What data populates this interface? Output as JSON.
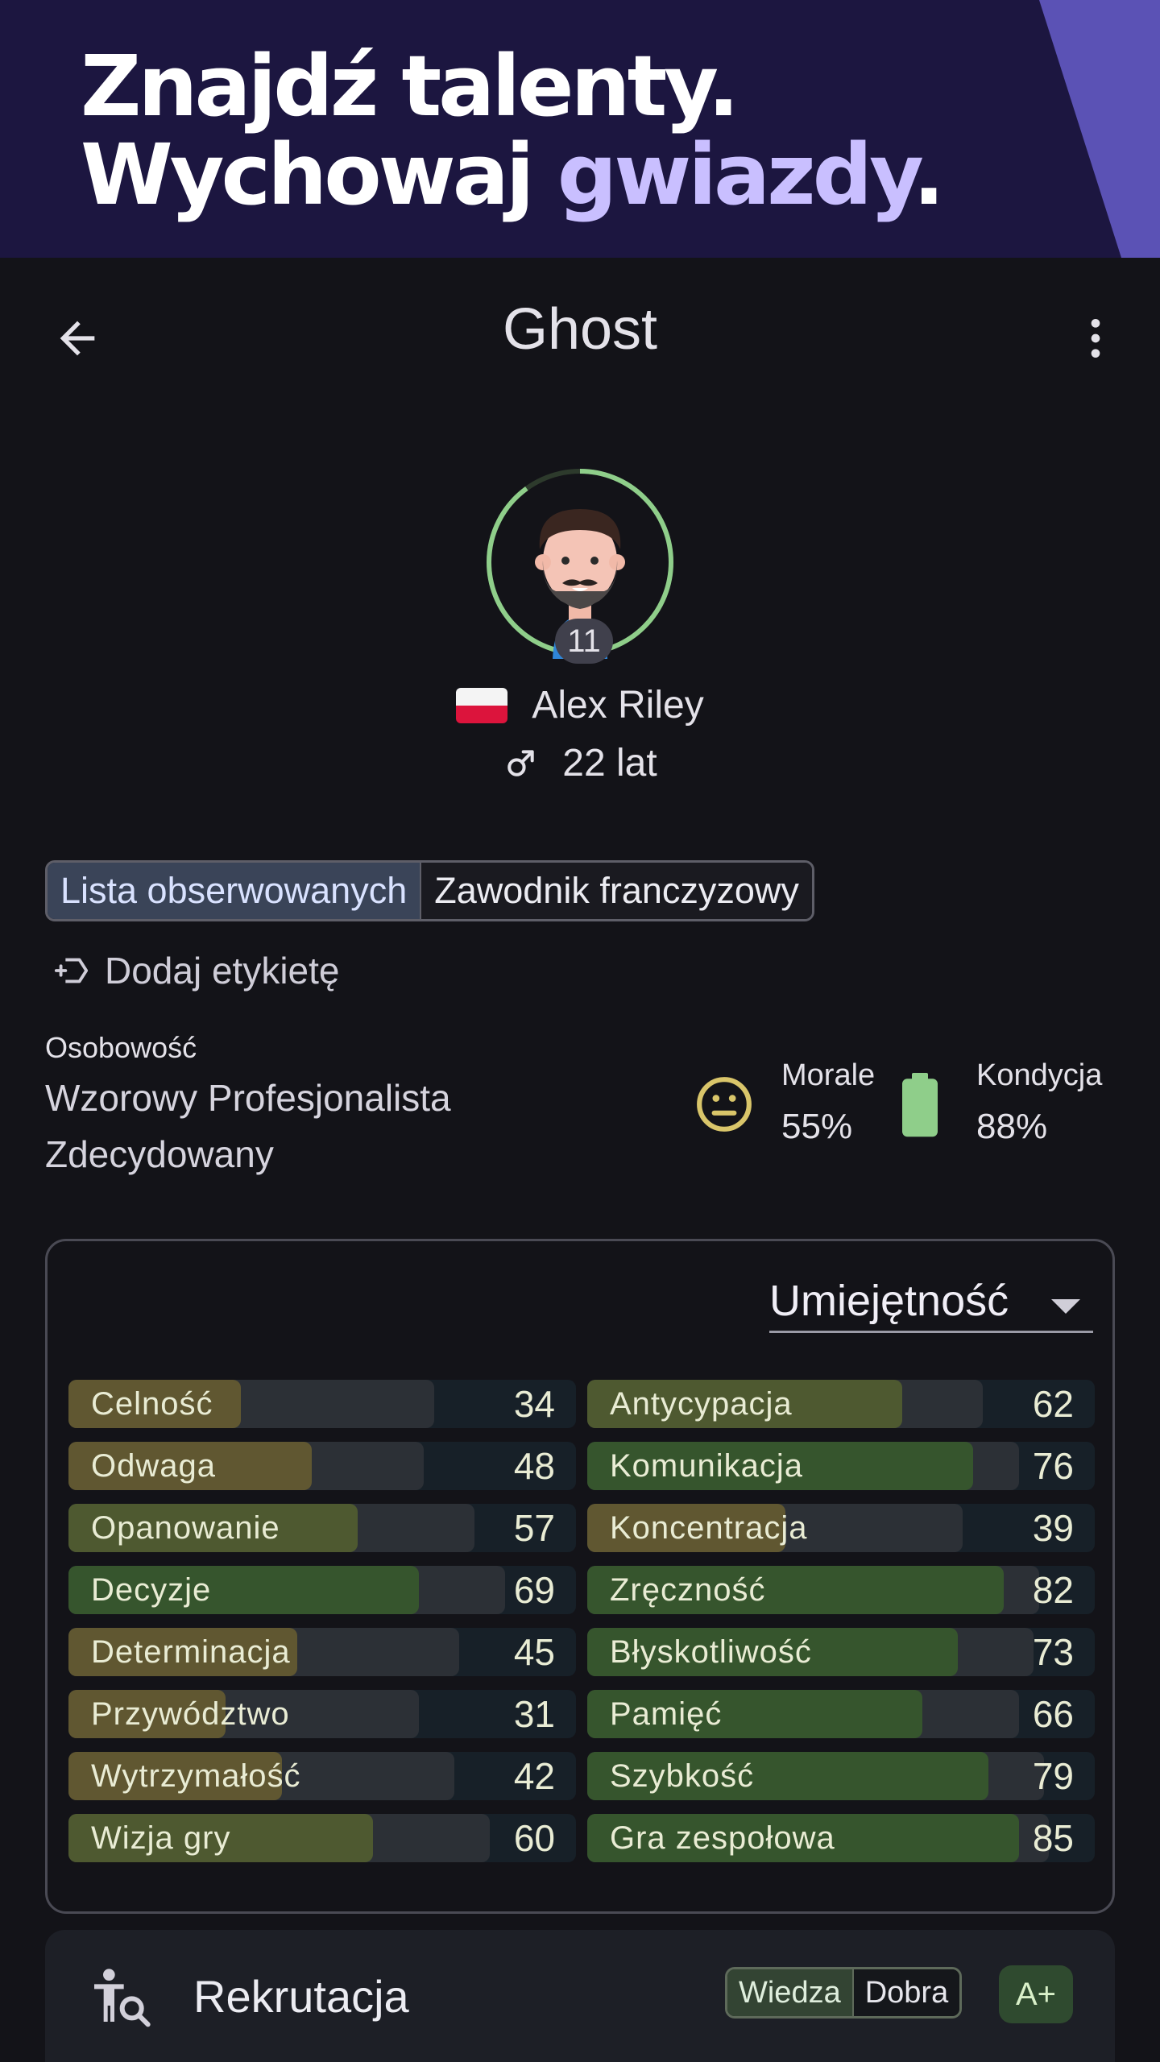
{
  "banner": {
    "line1": "Znajdź talenty.",
    "line2_start": "Wychowaj ",
    "line2_accent": "gwiazdy",
    "line2_end": "."
  },
  "header": {
    "title": "Ghost",
    "back_icon": "arrow-left-icon",
    "menu_icon": "more-vert-icon"
  },
  "player": {
    "level": "11",
    "name": "Alex Riley",
    "age": "22 lat",
    "nationality_flag": "poland-flag",
    "gender_icon": "male-icon",
    "ring_progress": 0.9
  },
  "tags": {
    "primary": "Lista obserwowanych",
    "secondary": "Zawodnik franczyzowy",
    "add_label": "Dodaj etykietę"
  },
  "personality": {
    "caption": "Osobowość",
    "line1": "Wzorowy Profesjonalista",
    "line2": "Zdecydowany"
  },
  "stats": {
    "morale": {
      "label": "Morale",
      "value": "55%"
    },
    "condition": {
      "label": "Kondycja",
      "value": "88%"
    }
  },
  "skills": {
    "selector": "Umiejętność",
    "left": [
      {
        "name": "Celność",
        "value": "34",
        "level": 34,
        "track": 72
      },
      {
        "name": "Odwaga",
        "value": "48",
        "level": 48,
        "track": 70
      },
      {
        "name": "Opanowanie",
        "value": "57",
        "level": 57,
        "track": 80
      },
      {
        "name": "Decyzje",
        "value": "69",
        "level": 69,
        "track": 86
      },
      {
        "name": "Determinacja",
        "value": "45",
        "level": 45,
        "track": 77
      },
      {
        "name": "Przywództwo",
        "value": "31",
        "level": 31,
        "track": 69
      },
      {
        "name": "Wytrzymałość",
        "value": "42",
        "level": 42,
        "track": 76
      },
      {
        "name": "Wizja gry",
        "value": "60",
        "level": 60,
        "track": 83
      }
    ],
    "right": [
      {
        "name": "Antycypacja",
        "value": "62",
        "level": 62,
        "track": 78
      },
      {
        "name": "Komunikacja",
        "value": "76",
        "level": 76,
        "track": 85
      },
      {
        "name": "Koncentracja",
        "value": "39",
        "level": 39,
        "track": 74
      },
      {
        "name": "Zręczność",
        "value": "82",
        "level": 82,
        "track": 89
      },
      {
        "name": "Błyskotliwość",
        "value": "73",
        "level": 73,
        "track": 88
      },
      {
        "name": "Pamięć",
        "value": "66",
        "level": 66,
        "track": 85
      },
      {
        "name": "Szybkość",
        "value": "79",
        "level": 79,
        "track": 90
      },
      {
        "name": "Gra zespołowa",
        "value": "85",
        "level": 85,
        "track": 91
      }
    ]
  },
  "recruitment": {
    "title": "Rekrutacja",
    "knowledge_label": "Wiedza",
    "knowledge_value": "Dobra",
    "grade": "A+"
  },
  "colors": {
    "accent_green": "#8fce8a",
    "morale_face": "#d9c56a",
    "battery": "#8fce8a",
    "banner_bg": "#1c1640",
    "banner_accent": "#c9bfff"
  }
}
